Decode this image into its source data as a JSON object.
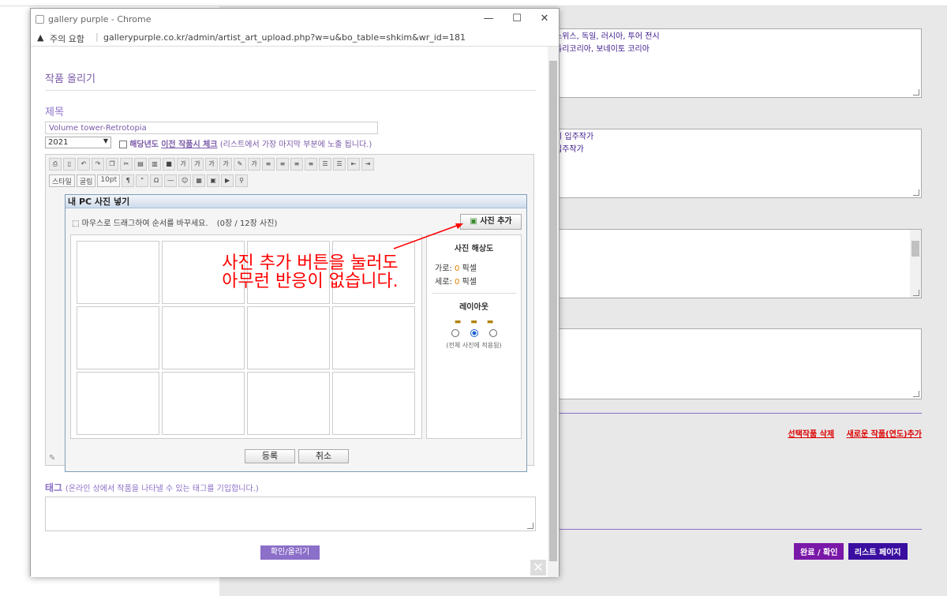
{
  "background": {
    "textarea1": [
      "스위스, 독일, 러시아, 투어 전시",
      "틀리코리아, 보네이토 코리아"
    ],
    "textarea2": [
      "시 입주작가",
      "입주작가"
    ],
    "links": [
      "선택작품 삭제",
      "새로운 작품(연도)추가"
    ],
    "buttons": {
      "confirm": "완료 / 확인",
      "list": "리스트 페이지"
    }
  },
  "window": {
    "title": "gallery purple - Chrome",
    "minimize": "—",
    "maximize": "☐",
    "close": "✕",
    "security": "주의 요함",
    "url": "gallerypurple.co.kr/admin/artist_art_upload.php?w=u&bo_table=shkim&wr_id=181"
  },
  "form": {
    "page_title": "작품 올리기",
    "title_label": "제목",
    "title_value": "Volume tower-Retrotopia",
    "year_value": "2021",
    "checkbox_text_1": "해당년도",
    "checkbox_link": "이전 작품시 체크",
    "checkbox_text_2": "(리스트에서 가장 마지막 부분에 노출 됩니다.)",
    "toolbar_style": "스타일",
    "toolbar_font": "굴림",
    "toolbar_size": "10pt",
    "tag_label": "태그",
    "tag_hint": "(온라인 상에서 작품을 나타낼 수 있는 태그를 기입합니다.)",
    "submit": "확인/올리기"
  },
  "modal": {
    "title": "내 PC 사진 넣기",
    "drag_hint": "마우스로 드래그하여 순서를 바꾸세요.",
    "count": "(0장 / 12장 사진)",
    "add_photo": "사진 추가",
    "resolution_title": "사진 해상도",
    "width_label": "가로:",
    "width_value": "0",
    "height_label": "세로:",
    "height_value": "0",
    "unit": "픽셀",
    "layout_title": "레이아웃",
    "layout_note": "(전체 사진에 적용됨)",
    "register": "등록",
    "cancel": "취소"
  },
  "annotation": {
    "line1": "사진 추가 버튼을 눌러도",
    "line2": "아무런 반응이 없습니다."
  },
  "colors": {
    "accent": "#8b6fc8",
    "annot": "#ff0000",
    "dark_purple": "#7a18a8",
    "navy": "#3a0ea0"
  }
}
